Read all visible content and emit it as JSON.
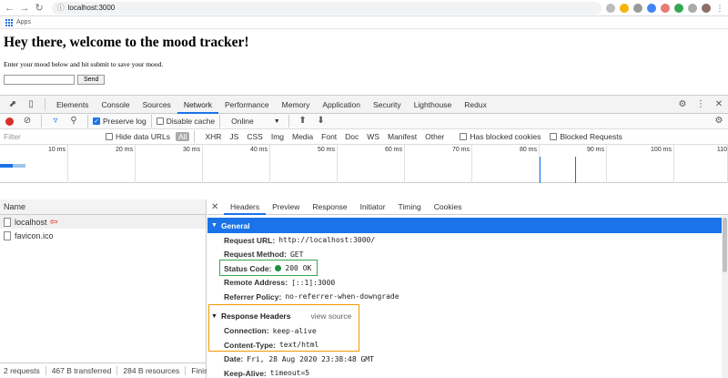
{
  "browser": {
    "url": "localhost:3000",
    "bookmarks_label": "Apps"
  },
  "page": {
    "heading": "Hey there, welcome to the mood tracker!",
    "intro": "Enter your mood below and hit submit to save your mood.",
    "mood_input_value": "",
    "send_label": "Send"
  },
  "devtools": {
    "tabs": [
      "Elements",
      "Console",
      "Sources",
      "Network",
      "Performance",
      "Memory",
      "Application",
      "Security",
      "Lighthouse",
      "Redux"
    ],
    "active_tab": "Network",
    "toolbar": {
      "preserve_log": "Preserve log",
      "disable_cache": "Disable cache",
      "throttle": "Online"
    },
    "filter": {
      "placeholder": "Filter",
      "hide_data_urls": "Hide data URLs",
      "types": [
        "All",
        "XHR",
        "JS",
        "CSS",
        "Img",
        "Media",
        "Font",
        "Doc",
        "WS",
        "Manifest",
        "Other"
      ],
      "blocked_cookies": "Has blocked cookies",
      "blocked_requests": "Blocked Requests"
    },
    "timeline_ticks": [
      "10 ms",
      "20 ms",
      "30 ms",
      "40 ms",
      "50 ms",
      "60 ms",
      "70 ms",
      "80 ms",
      "90 ms",
      "100 ms",
      "110"
    ],
    "name_header": "Name",
    "requests": [
      "localhost",
      "favicon.ico"
    ],
    "status": {
      "requests": "2 requests",
      "transferred": "467 B transferred",
      "resources": "284 B resources",
      "finish": "Finis"
    },
    "detail_tabs": [
      "Headers",
      "Preview",
      "Response",
      "Initiator",
      "Timing",
      "Cookies"
    ],
    "general": {
      "title": "General",
      "request_url_label": "Request URL:",
      "request_url": "http://localhost:3000/",
      "method_label": "Request Method:",
      "method": "GET",
      "status_label": "Status Code:",
      "status": "200 OK",
      "remote_label": "Remote Address:",
      "remote": "[::1]:3000",
      "referrer_label": "Referrer Policy:",
      "referrer": "no-referrer-when-downgrade"
    },
    "response_headers": {
      "title": "Response Headers",
      "view_source": "view source",
      "connection_label": "Connection:",
      "connection": "keep-alive",
      "content_type_label": "Content-Type:",
      "content_type": "text/html",
      "date_label": "Date:",
      "date": "Fri, 28 Aug 2020 23:38:48 GMT",
      "keepalive_label": "Keep-Alive:",
      "keepalive": "timeout=5"
    }
  },
  "colors": {
    "accent": "#1a73e8",
    "record": "#d93025",
    "annotation_green": "#34a853",
    "annotation_orange": "#f29900"
  }
}
